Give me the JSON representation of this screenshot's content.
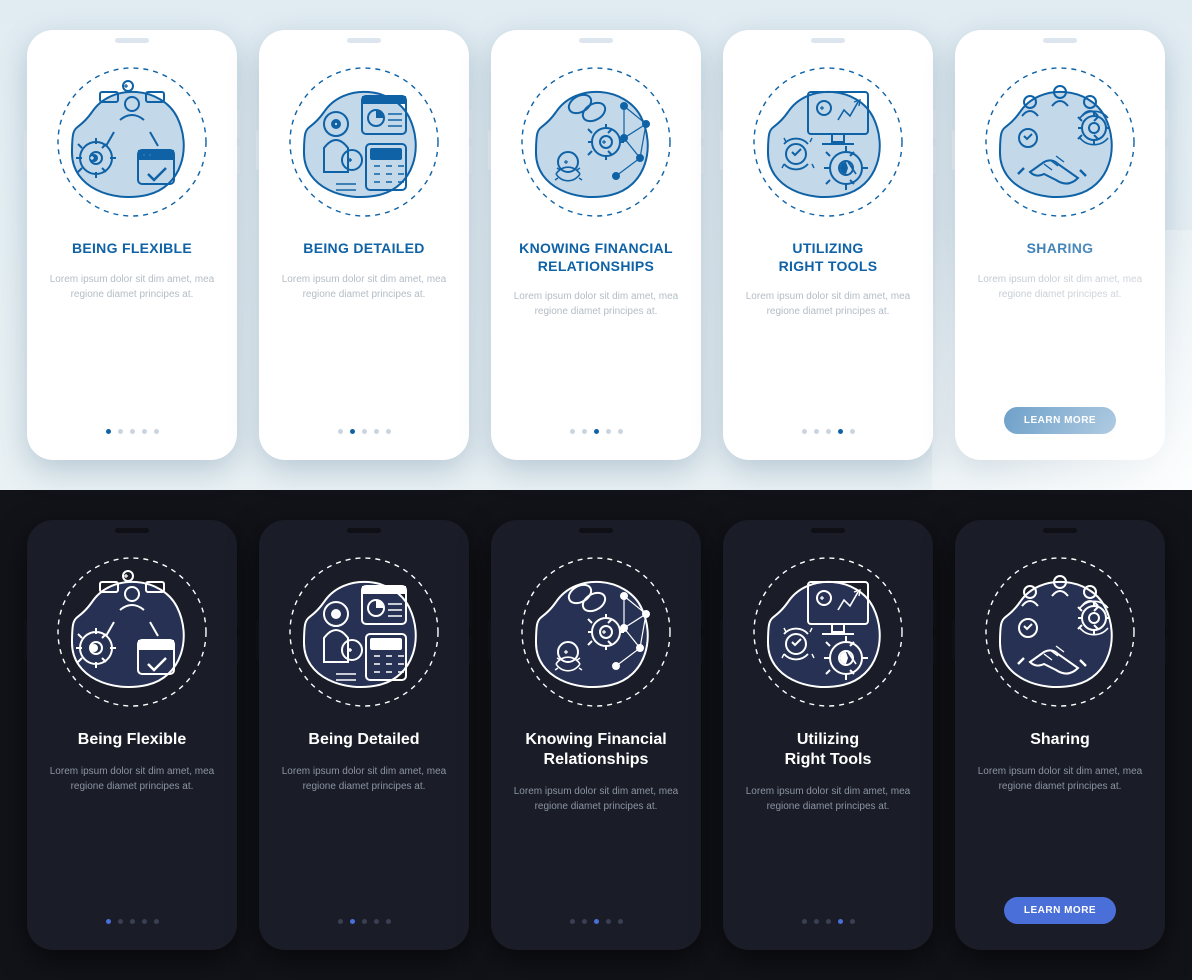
{
  "shared": {
    "body_text": "Lorem ipsum dolor sit dim amet, mea regione diamet principes at.",
    "cta_label": "LEARN MORE"
  },
  "slides": [
    {
      "id": "flexible",
      "title_light": "BEING FLEXIBLE",
      "title_dark": "Being Flexible",
      "active_dot": 0,
      "has_cta": false
    },
    {
      "id": "detailed",
      "title_light": "BEING DETAILED",
      "title_dark": "Being Detailed",
      "active_dot": 1,
      "has_cta": false
    },
    {
      "id": "relationships",
      "title_light": "KNOWING FINANCIAL\nRELATIONSHIPS",
      "title_dark": "Knowing Financial\nRelationships",
      "active_dot": 2,
      "has_cta": false
    },
    {
      "id": "tools",
      "title_light": "UTILIZING\nRIGHT TOOLS",
      "title_dark": "Utilizing\nRight Tools",
      "active_dot": 3,
      "has_cta": false
    },
    {
      "id": "sharing",
      "title_light": "SHARING",
      "title_dark": "Sharing",
      "active_dot": 4,
      "has_cta": true
    }
  ],
  "dot_count": 5,
  "colors": {
    "accent_light": "#0f62a6",
    "accent_dark": "#4a6fd8"
  }
}
